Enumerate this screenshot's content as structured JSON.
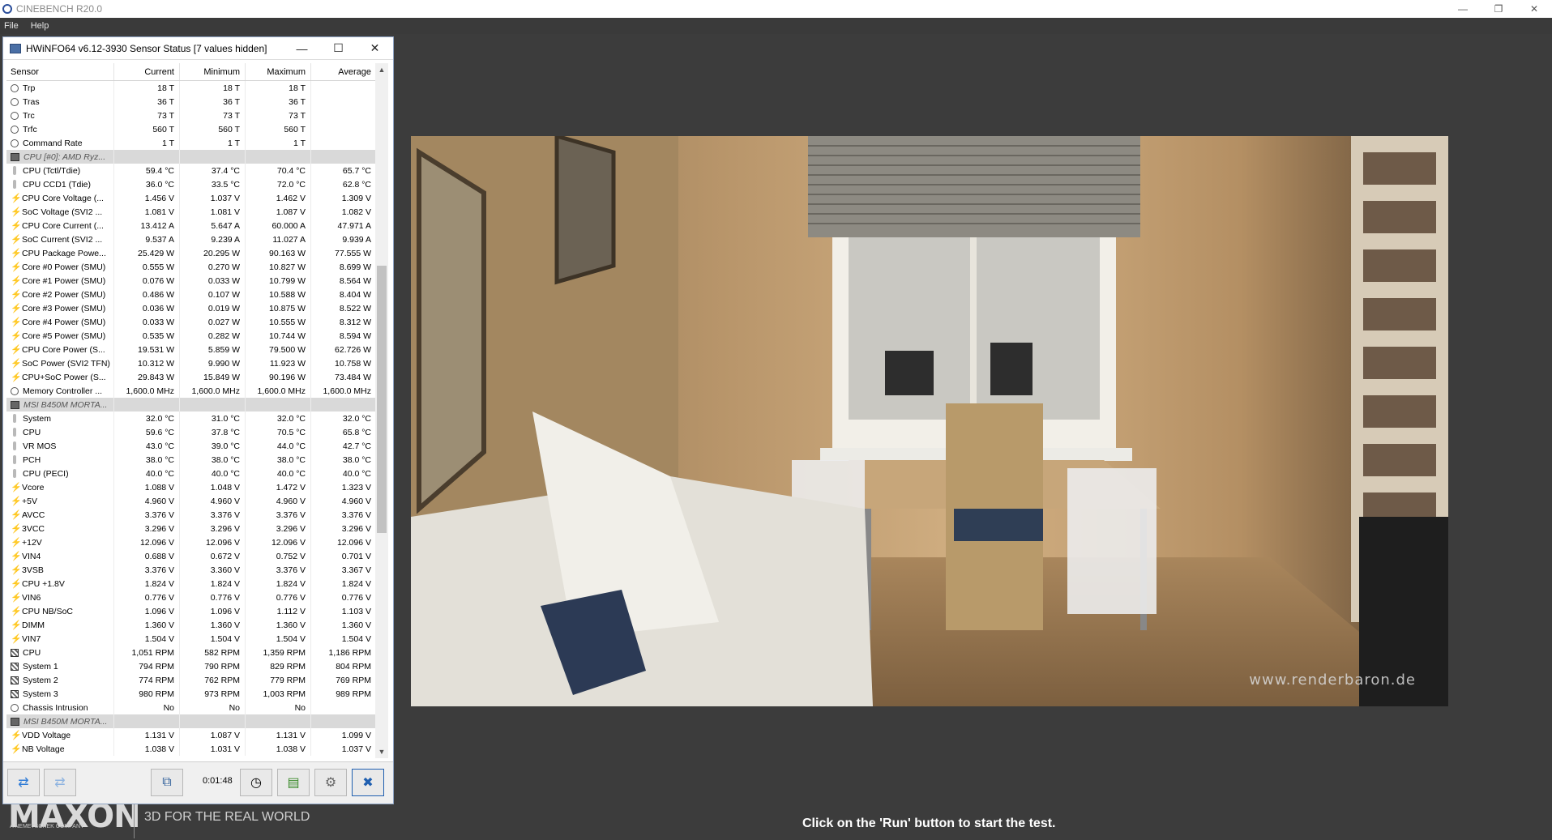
{
  "cinebench": {
    "title": "CINEBENCH R20.0",
    "menu": [
      "File",
      "Help"
    ],
    "watermark": "www.renderbaron.de",
    "logo_text": "MAXON",
    "logo_sub": "A NEMETSCHEK COMPANY",
    "tagline": "3D FOR THE REAL WORLD",
    "hint": "Click on the 'Run' button to start the test."
  },
  "hwinfo": {
    "title": "HWiNFO64 v6.12-3930 Sensor Status [7 values hidden]",
    "columns": [
      "Sensor",
      "Current",
      "Minimum",
      "Maximum",
      "Average"
    ],
    "timer": "0:01:48",
    "rows": [
      {
        "icon": "clock",
        "name": "Trp",
        "cur": "18 T",
        "min": "18 T",
        "max": "18 T",
        "avg": ""
      },
      {
        "icon": "clock",
        "name": "Tras",
        "cur": "36 T",
        "min": "36 T",
        "max": "36 T",
        "avg": ""
      },
      {
        "icon": "clock",
        "name": "Trc",
        "cur": "73 T",
        "min": "73 T",
        "max": "73 T",
        "avg": ""
      },
      {
        "icon": "clock",
        "name": "Trfc",
        "cur": "560 T",
        "min": "560 T",
        "max": "560 T",
        "avg": ""
      },
      {
        "icon": "clock",
        "name": "Command Rate",
        "cur": "1 T",
        "min": "1 T",
        "max": "1 T",
        "avg": ""
      },
      {
        "icon": "chip",
        "name": "CPU [#0]: AMD Ryz...",
        "group": true,
        "cur": "",
        "min": "",
        "max": "",
        "avg": ""
      },
      {
        "icon": "therm",
        "name": "CPU (Tctl/Tdie)",
        "cur": "59.4 °C",
        "min": "37.4 °C",
        "max": "70.4 °C",
        "avg": "65.7 °C"
      },
      {
        "icon": "therm",
        "name": "CPU CCD1 (Tdie)",
        "cur": "36.0 °C",
        "min": "33.5 °C",
        "max": "72.0 °C",
        "avg": "62.8 °C"
      },
      {
        "icon": "volt",
        "name": "CPU Core Voltage (...",
        "cur": "1.456 V",
        "min": "1.037 V",
        "max": "1.462 V",
        "avg": "1.309 V"
      },
      {
        "icon": "volt",
        "name": "SoC Voltage (SVI2 ...",
        "cur": "1.081 V",
        "min": "1.081 V",
        "max": "1.087 V",
        "avg": "1.082 V"
      },
      {
        "icon": "volt",
        "name": "CPU Core Current (...",
        "cur": "13.412 A",
        "min": "5.647 A",
        "max": "60.000 A",
        "avg": "47.971 A"
      },
      {
        "icon": "volt",
        "name": "SoC Current (SVI2 ...",
        "cur": "9.537 A",
        "min": "9.239 A",
        "max": "11.027 A",
        "avg": "9.939 A"
      },
      {
        "icon": "volt",
        "name": "CPU Package Powe...",
        "cur": "25.429 W",
        "min": "20.295 W",
        "max": "90.163 W",
        "avg": "77.555 W"
      },
      {
        "icon": "volt",
        "name": "Core #0 Power (SMU)",
        "cur": "0.555 W",
        "min": "0.270 W",
        "max": "10.827 W",
        "avg": "8.699 W"
      },
      {
        "icon": "volt",
        "name": "Core #1 Power (SMU)",
        "cur": "0.076 W",
        "min": "0.033 W",
        "max": "10.799 W",
        "avg": "8.564 W"
      },
      {
        "icon": "volt",
        "name": "Core #2 Power (SMU)",
        "cur": "0.486 W",
        "min": "0.107 W",
        "max": "10.588 W",
        "avg": "8.404 W"
      },
      {
        "icon": "volt",
        "name": "Core #3 Power (SMU)",
        "cur": "0.036 W",
        "min": "0.019 W",
        "max": "10.875 W",
        "avg": "8.522 W"
      },
      {
        "icon": "volt",
        "name": "Core #4 Power (SMU)",
        "cur": "0.033 W",
        "min": "0.027 W",
        "max": "10.555 W",
        "avg": "8.312 W"
      },
      {
        "icon": "volt",
        "name": "Core #5 Power (SMU)",
        "cur": "0.535 W",
        "min": "0.282 W",
        "max": "10.744 W",
        "avg": "8.594 W"
      },
      {
        "icon": "volt",
        "name": "CPU Core Power (S...",
        "cur": "19.531 W",
        "min": "5.859 W",
        "max": "79.500 W",
        "avg": "62.726 W"
      },
      {
        "icon": "volt",
        "name": "SoC Power (SVI2 TFN)",
        "cur": "10.312 W",
        "min": "9.990 W",
        "max": "11.923 W",
        "avg": "10.758 W"
      },
      {
        "icon": "volt",
        "name": "CPU+SoC Power (S...",
        "cur": "29.843 W",
        "min": "15.849 W",
        "max": "90.196 W",
        "avg": "73.484 W"
      },
      {
        "icon": "clock",
        "name": "Memory Controller ...",
        "cur": "1,600.0 MHz",
        "min": "1,600.0 MHz",
        "max": "1,600.0 MHz",
        "avg": "1,600.0 MHz"
      },
      {
        "icon": "chip",
        "name": "MSI B450M MORTA...",
        "group": true,
        "cur": "",
        "min": "",
        "max": "",
        "avg": ""
      },
      {
        "icon": "therm",
        "name": "System",
        "cur": "32.0 °C",
        "min": "31.0 °C",
        "max": "32.0 °C",
        "avg": "32.0 °C"
      },
      {
        "icon": "therm",
        "name": "CPU",
        "cur": "59.6 °C",
        "min": "37.8 °C",
        "max": "70.5 °C",
        "avg": "65.8 °C"
      },
      {
        "icon": "therm",
        "name": "VR MOS",
        "cur": "43.0 °C",
        "min": "39.0 °C",
        "max": "44.0 °C",
        "avg": "42.7 °C"
      },
      {
        "icon": "therm",
        "name": "PCH",
        "cur": "38.0 °C",
        "min": "38.0 °C",
        "max": "38.0 °C",
        "avg": "38.0 °C"
      },
      {
        "icon": "therm",
        "name": "CPU (PECI)",
        "cur": "40.0 °C",
        "min": "40.0 °C",
        "max": "40.0 °C",
        "avg": "40.0 °C"
      },
      {
        "icon": "volt",
        "name": "Vcore",
        "cur": "1.088 V",
        "min": "1.048 V",
        "max": "1.472 V",
        "avg": "1.323 V"
      },
      {
        "icon": "volt",
        "name": "+5V",
        "cur": "4.960 V",
        "min": "4.960 V",
        "max": "4.960 V",
        "avg": "4.960 V"
      },
      {
        "icon": "volt",
        "name": "AVCC",
        "cur": "3.376 V",
        "min": "3.376 V",
        "max": "3.376 V",
        "avg": "3.376 V"
      },
      {
        "icon": "volt",
        "name": "3VCC",
        "cur": "3.296 V",
        "min": "3.296 V",
        "max": "3.296 V",
        "avg": "3.296 V"
      },
      {
        "icon": "volt",
        "name": "+12V",
        "cur": "12.096 V",
        "min": "12.096 V",
        "max": "12.096 V",
        "avg": "12.096 V"
      },
      {
        "icon": "volt",
        "name": "VIN4",
        "cur": "0.688 V",
        "min": "0.672 V",
        "max": "0.752 V",
        "avg": "0.701 V"
      },
      {
        "icon": "volt",
        "name": "3VSB",
        "cur": "3.376 V",
        "min": "3.360 V",
        "max": "3.376 V",
        "avg": "3.367 V"
      },
      {
        "icon": "volt",
        "name": "CPU +1.8V",
        "cur": "1.824 V",
        "min": "1.824 V",
        "max": "1.824 V",
        "avg": "1.824 V"
      },
      {
        "icon": "volt",
        "name": "VIN6",
        "cur": "0.776 V",
        "min": "0.776 V",
        "max": "0.776 V",
        "avg": "0.776 V"
      },
      {
        "icon": "volt",
        "name": "CPU NB/SoC",
        "cur": "1.096 V",
        "min": "1.096 V",
        "max": "1.112 V",
        "avg": "1.103 V"
      },
      {
        "icon": "volt",
        "name": "DIMM",
        "cur": "1.360 V",
        "min": "1.360 V",
        "max": "1.360 V",
        "avg": "1.360 V"
      },
      {
        "icon": "volt",
        "name": "VIN7",
        "cur": "1.504 V",
        "min": "1.504 V",
        "max": "1.504 V",
        "avg": "1.504 V"
      },
      {
        "icon": "fan",
        "name": "CPU",
        "cur": "1,051 RPM",
        "min": "582 RPM",
        "max": "1,359 RPM",
        "avg": "1,186 RPM"
      },
      {
        "icon": "fan",
        "name": "System 1",
        "cur": "794 RPM",
        "min": "790 RPM",
        "max": "829 RPM",
        "avg": "804 RPM"
      },
      {
        "icon": "fan",
        "name": "System 2",
        "cur": "774 RPM",
        "min": "762 RPM",
        "max": "779 RPM",
        "avg": "769 RPM"
      },
      {
        "icon": "fan",
        "name": "System 3",
        "cur": "980 RPM",
        "min": "973 RPM",
        "max": "1,003 RPM",
        "avg": "989 RPM"
      },
      {
        "icon": "clock",
        "name": "Chassis Intrusion",
        "cur": "No",
        "min": "No",
        "max": "No",
        "avg": ""
      },
      {
        "icon": "chip",
        "name": "MSI B450M MORTA...",
        "group": true,
        "cur": "",
        "min": "",
        "max": "",
        "avg": ""
      },
      {
        "icon": "volt",
        "name": "VDD Voltage",
        "cur": "1.131 V",
        "min": "1.087 V",
        "max": "1.131 V",
        "avg": "1.099 V"
      },
      {
        "icon": "volt",
        "name": "NB Voltage",
        "cur": "1.038 V",
        "min": "1.031 V",
        "max": "1.038 V",
        "avg": "1.037 V"
      }
    ]
  }
}
